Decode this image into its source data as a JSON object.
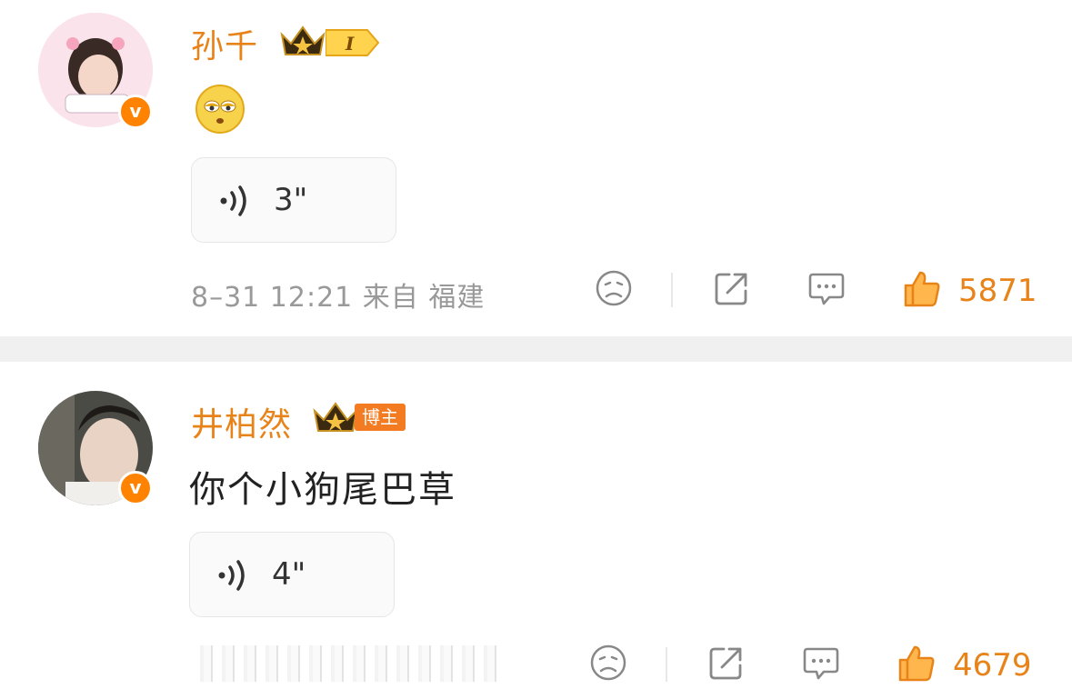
{
  "comments": [
    {
      "username": "孙千",
      "level_badge": "I",
      "content_emoji": "emoji-rolling-eyes",
      "voice": {
        "duration": "3\""
      },
      "meta": "8–31 12:21 来自 福建",
      "likes": "5871"
    },
    {
      "username": "井柏然",
      "host_badge": "博主",
      "content": "你个小狗尾巴草",
      "voice": {
        "duration": "4\""
      },
      "likes": "4679"
    }
  ],
  "colors": {
    "username": "#e8831a",
    "verified": "#ff8200",
    "like": "#e8831a",
    "meta": "#999999"
  }
}
